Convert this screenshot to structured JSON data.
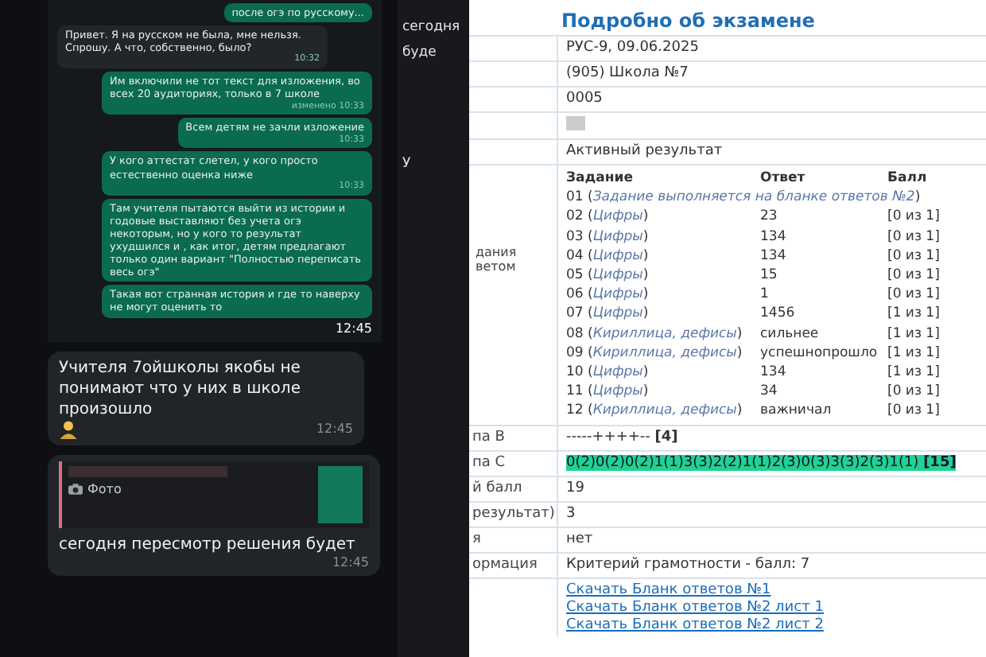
{
  "chat": {
    "screenshot": {
      "messages": [
        {
          "kind": "outgoing",
          "text": "после огэ по русскому..."
        },
        {
          "kind": "incoming",
          "text": "Привет. Я на русском не была, мне нельзя. Спрошу. А что, собственно, было?",
          "time": "10:32"
        },
        {
          "kind": "outgoing",
          "text": "Им включили не тот текст для изложения, во всех 20 аудиториях, только в 7 школе",
          "time": "10:33",
          "edited_label": "изменено"
        },
        {
          "kind": "outgoing",
          "text": "Всем детям не зачли изложение",
          "time": "10:33"
        },
        {
          "kind": "outgoing",
          "text": "У кого аттестат слетел, у кого просто естественно оценка ниже",
          "time": "10:33"
        },
        {
          "kind": "outgoing",
          "text": "Там учителя пытаются выйти из истории и годовые выставляют без учета огэ некоторым, но у кого то результат ухудшился и , как итог, детям предлагают только один вариант \"Полностью переписать весь огэ\""
        },
        {
          "kind": "outgoing",
          "text": "Такая вот странная история и где то наверху не могут оценить то"
        }
      ],
      "time": "12:45"
    },
    "messages": [
      {
        "kind": "incoming",
        "text": "Учителя 7ойшколы якобы не понимают что у них в школе произошло",
        "emoji": true,
        "time": "12:45"
      },
      {
        "kind": "reply",
        "quote": "Фото",
        "text": "сегодня пересмотр решения будет",
        "time": "12:45"
      }
    ],
    "side_fragments": [
      "сегодня",
      "буде",
      "У"
    ]
  },
  "exam": {
    "title": "Подробно об экзамене",
    "info_rows": [
      "РУС-9, 09.06.2025",
      "(905) Школа №7",
      "0005",
      "",
      "Активный результат"
    ],
    "tasks_label": [
      "дания",
      "ветом"
    ],
    "task_columns": [
      "Задание",
      "Ответ",
      "Балл"
    ],
    "tasks": [
      {
        "task": "01 (*Задание выполняется на бланке ответов №2*)"
      },
      {
        "task": "02 (*Цифры*)",
        "answer": "23",
        "score": "[0 из 1]"
      },
      {
        "task": "03 (*Цифры*)",
        "answer": "134",
        "score": "[0 из 1]"
      },
      {
        "task": "04 (*Цифры*)",
        "answer": "134",
        "score": "[0 из 1]"
      },
      {
        "task": "05 (*Цифры*)",
        "answer": "15",
        "score": "[0 из 1]"
      },
      {
        "task": "06 (*Цифры*)",
        "answer": "1",
        "score": "[0 из 1]"
      },
      {
        "task": "07 (*Цифры*)",
        "answer": "1456",
        "score": "[1 из 1]"
      },
      {
        "task": "08 (*Кириллица, дефисы*)",
        "answer": "сильнее",
        "score": "[1 из 1]"
      },
      {
        "task": "09 (*Кириллица, дефисы*)",
        "answer": "успешнопрошло",
        "score": "[1 из 1]"
      },
      {
        "task": "10 (*Цифры*)",
        "answer": "134",
        "score": "[1 из 1]"
      },
      {
        "task": "11 (*Цифры*)",
        "answer": "34",
        "score": "[0 из 1]"
      },
      {
        "task": "12 (*Кириллица, дефисы*)",
        "answer": "важничал",
        "score": "[0 из 1]"
      }
    ],
    "result_rows": [
      {
        "label": "па В",
        "value": "-----++++-- **[4]**",
        "highlight": false
      },
      {
        "label": "па С",
        "value": "0(2)0(2)0(2)1(1)3(3)2(2)1(1)2(3)0(3)3(3)2(3)1(1) **[15]**",
        "highlight": true
      },
      {
        "label": "й балл",
        "value": "19",
        "highlight": false
      },
      {
        "label": "результат)",
        "value": "3",
        "highlight": false
      },
      {
        "label": "я",
        "value": "нет",
        "highlight": false
      },
      {
        "label": "ормация",
        "value": "Критерий грамотности - балл: 7",
        "highlight": false
      }
    ],
    "links": [
      "Скачать Бланк ответов №1",
      "Скачать Бланк ответов №2 лист 1",
      "Скачать Бланк ответов №2 лист 2"
    ]
  }
}
